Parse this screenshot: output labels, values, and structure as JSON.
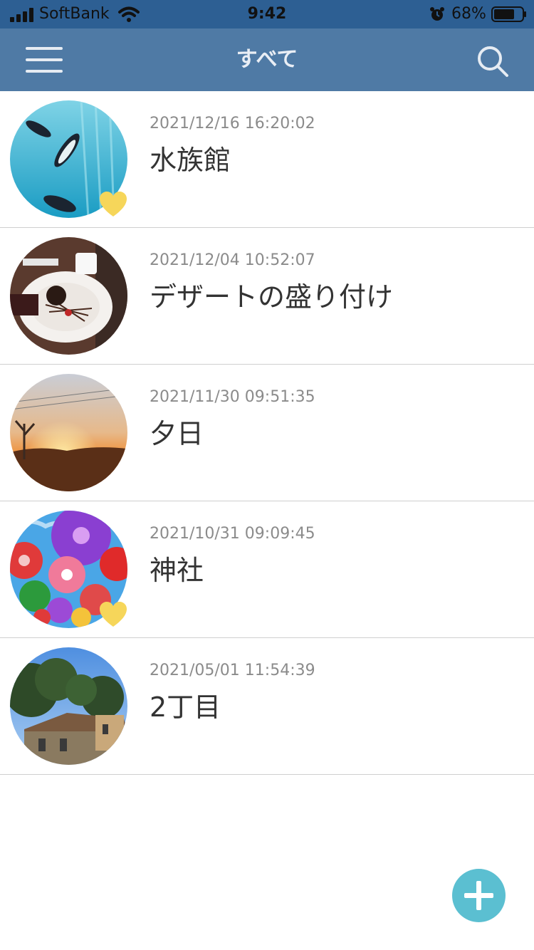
{
  "status_bar": {
    "carrier": "SoftBank",
    "time": "9:42",
    "battery": "68%"
  },
  "nav": {
    "title": "すべて",
    "menu_icon": "hamburger-menu-icon",
    "search_icon": "search-icon"
  },
  "entries": [
    {
      "date": "2021/12/16 16:20:02",
      "title": "水族館",
      "favorite": true,
      "thumbnail": "penguins in aquarium"
    },
    {
      "date": "2021/12/04 10:52:07",
      "title": "デザートの盛り付け",
      "favorite": false,
      "thumbnail": "dessert plate"
    },
    {
      "date": "2021/11/30 09:51:35",
      "title": "夕日",
      "favorite": false,
      "thumbnail": "sunset"
    },
    {
      "date": "2021/10/31 09:09:45",
      "title": "神社",
      "favorite": true,
      "thumbnail": "paper umbrellas"
    },
    {
      "date": "2021/05/01 11:54:39",
      "title": "2丁目",
      "favorite": false,
      "thumbnail": "trees and house"
    }
  ],
  "colors": {
    "status_bar": "#2d5f93",
    "nav_bar": "#4f7aa5",
    "favorite": "#f6d65a",
    "fab": "#5bbfd1"
  },
  "fab_icon": "plus-icon"
}
